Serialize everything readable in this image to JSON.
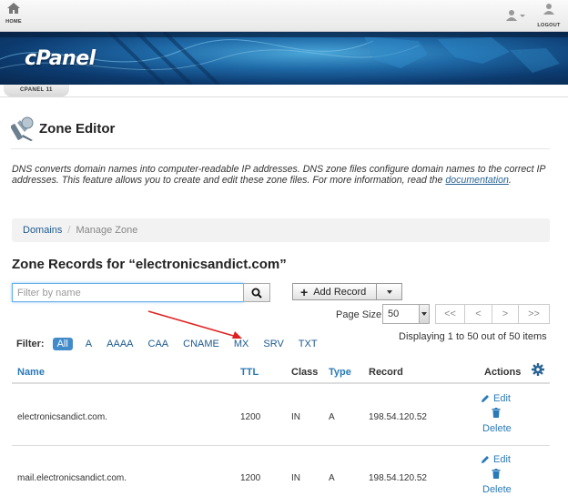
{
  "topbar": {
    "home_label": "HOME",
    "logout_label": "LOGOUT"
  },
  "banner": {
    "logo_text": "cPanel"
  },
  "version": {
    "label": "CPANEL 11"
  },
  "page": {
    "title": "Zone Editor",
    "description_prefix": "DNS converts domain names into computer-readable IP addresses. DNS zone files configure domain names to the correct IP addresses. This feature allows you to create and edit these zone files. For more information, read the ",
    "description_link": "documentation",
    "description_suffix": "."
  },
  "breadcrumb": {
    "link": "Domains",
    "separator": "/",
    "current": "Manage Zone"
  },
  "zone": {
    "title": "Zone Records for “electronicsandict.com”"
  },
  "search": {
    "placeholder": "Filter by name"
  },
  "add_record": {
    "label": "Add Record"
  },
  "page_size": {
    "label": "Page Size",
    "value": "50"
  },
  "pager": {
    "first": "<<",
    "prev": "<",
    "next": ">",
    "last": ">>"
  },
  "filter": {
    "label": "Filter:",
    "options": [
      "All",
      "A",
      "AAAA",
      "CAA",
      "CNAME",
      "MX",
      "SRV",
      "TXT"
    ],
    "active": "All"
  },
  "display_info": "Displaying 1 to 50 out of 50 items",
  "table": {
    "headers": {
      "name": "Name",
      "ttl": "TTL",
      "class": "Class",
      "type": "Type",
      "record": "Record",
      "actions": "Actions"
    },
    "rows": [
      {
        "name": "electronicsandict.com.",
        "ttl": "1200",
        "class": "IN",
        "type": "A",
        "record": "198.54.120.52",
        "edit": "Edit",
        "delete": "Delete"
      },
      {
        "name": "mail.electronicsandict.com.",
        "ttl": "1200",
        "class": "IN",
        "type": "A",
        "record": "198.54.120.52",
        "edit": "Edit",
        "delete": "Delete"
      }
    ]
  },
  "colors": {
    "link": "#2a7ab8",
    "active_filter": "#428bca",
    "annotation_arrow": "#e02020"
  }
}
